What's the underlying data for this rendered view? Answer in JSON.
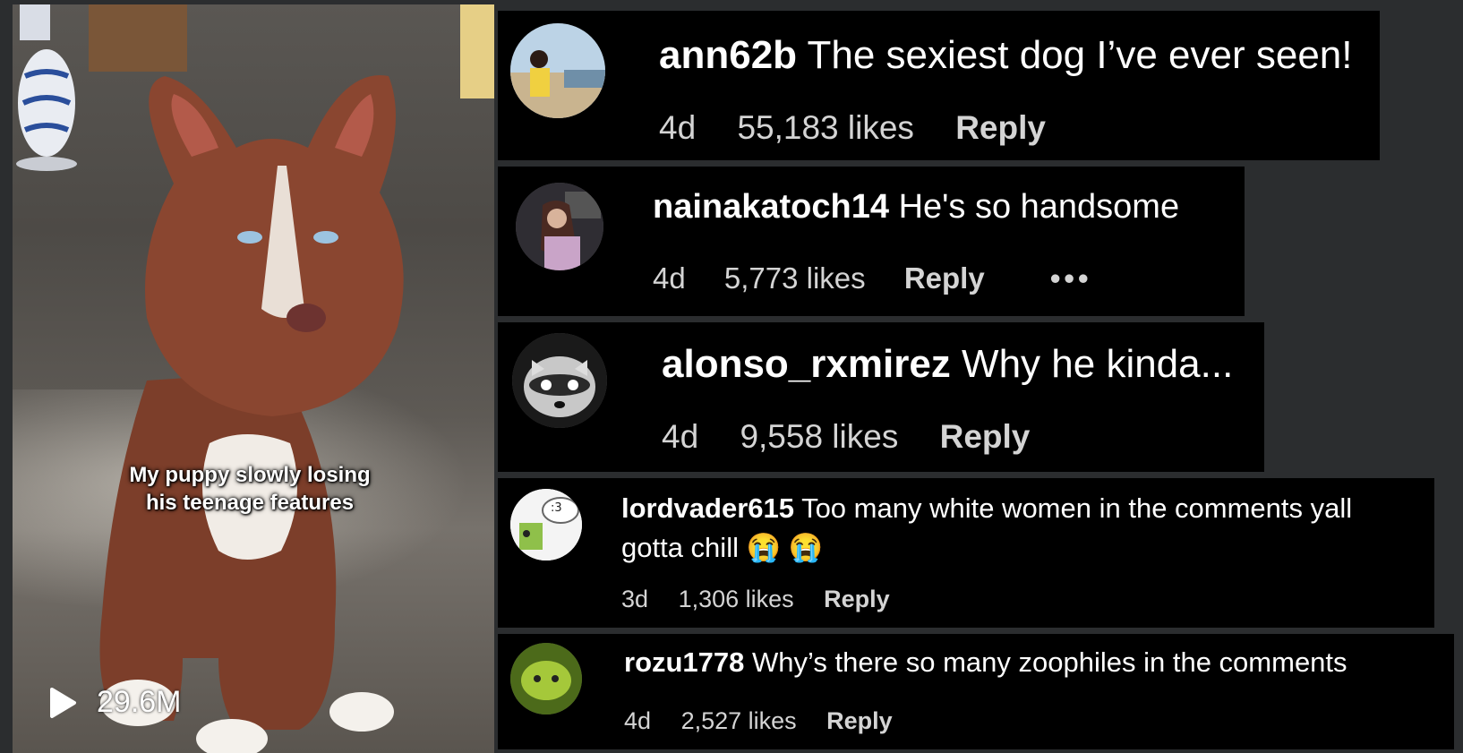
{
  "video": {
    "caption_line1": "My puppy slowly losing",
    "caption_line2": "his teenage features",
    "views": "29.6M",
    "play_icon": "play-icon"
  },
  "comments": [
    {
      "user": "ann62b",
      "text": "The sexiest dog I’ve ever seen!",
      "age": "4d",
      "likes": "55,183 likes",
      "reply": "Reply"
    },
    {
      "user": "nainakatoch14",
      "text": "He's so handsome",
      "age": "4d",
      "likes": "5,773 likes",
      "reply": "Reply",
      "more": "•••"
    },
    {
      "user": "alonso_rxmirez",
      "text": "Why he kinda...",
      "age": "4d",
      "likes": "9,558 likes",
      "reply": "Reply"
    },
    {
      "user": "lordvader615",
      "text": "Too many white women in the comments yall",
      "text2": "gotta chill 😭 😭",
      "avatar_text": ":3",
      "age": "3d",
      "likes": "1,306 likes",
      "reply": "Reply"
    },
    {
      "user": "rozu1778",
      "text": "Why’s there so many zoophiles in the comments",
      "age": "4d",
      "likes": "2,527 likes",
      "reply": "Reply"
    }
  ]
}
